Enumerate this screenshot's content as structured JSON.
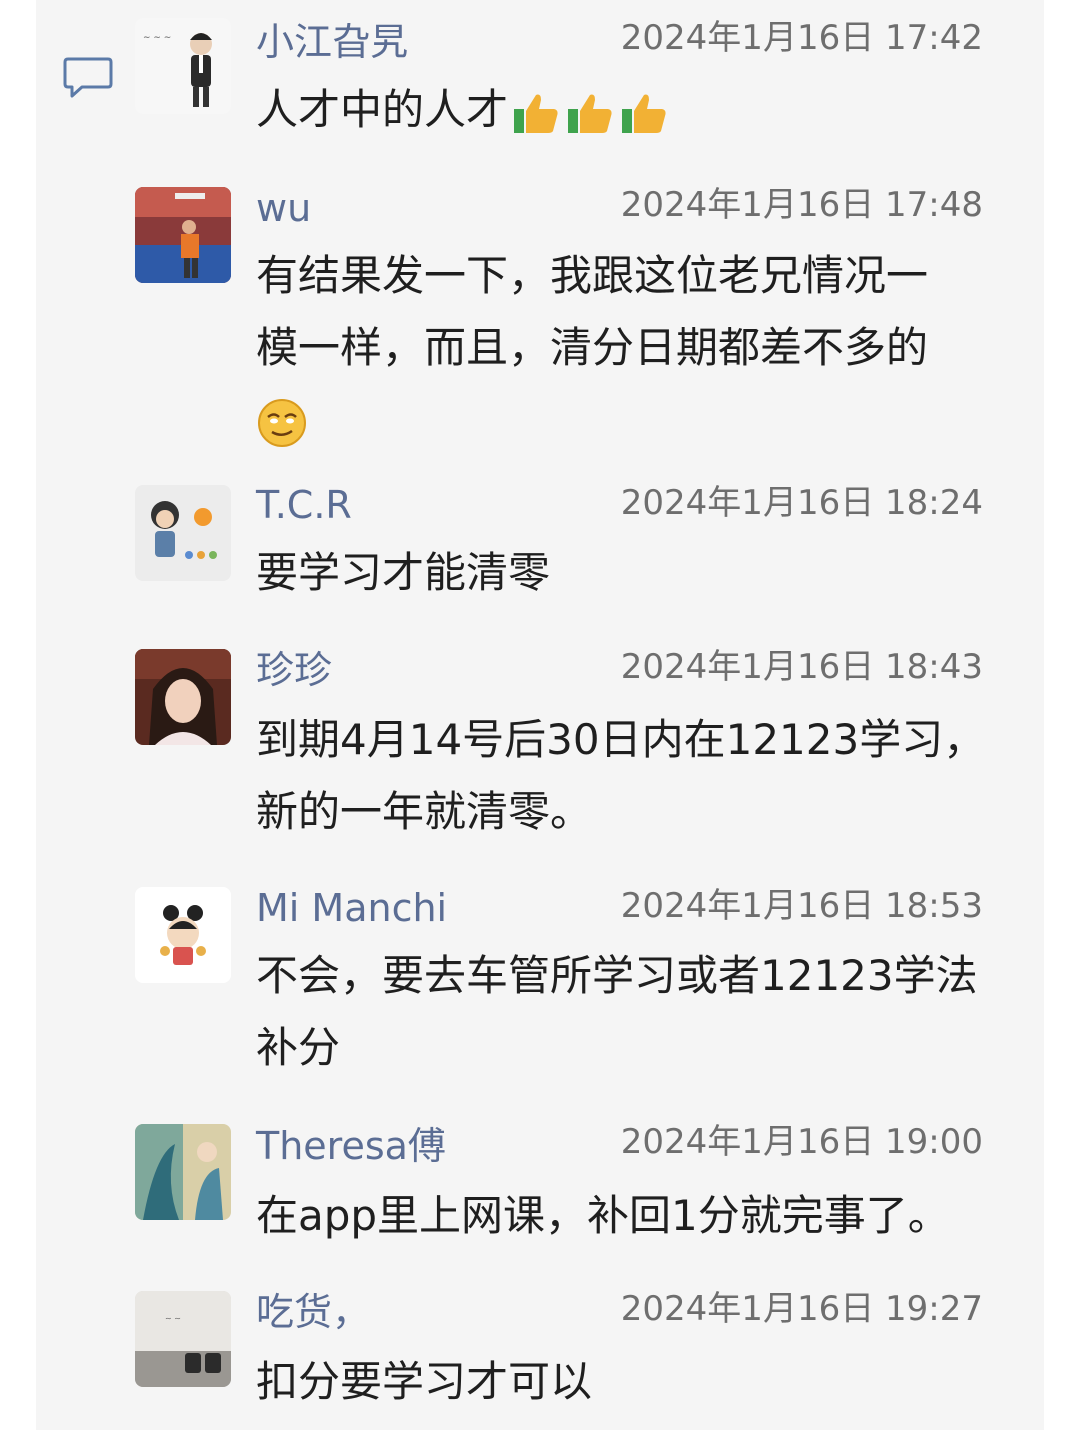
{
  "comments": [
    {
      "name": "小江旮旯",
      "time": "2024年1月16日 17:42",
      "text": "人才中的人才",
      "emojis": [
        "thumbs-up-icon",
        "thumbs-up-icon",
        "thumbs-up-icon"
      ]
    },
    {
      "name": "wu",
      "time": "2024年1月16日 17:48",
      "text_lines": [
        "有结果发一下，我跟这位老兄情况一",
        "模一样，而且，清分日期都差不多的"
      ],
      "emojis": [
        "smirk-face-icon"
      ]
    },
    {
      "name": "T.C.R",
      "time": "2024年1月16日 18:24",
      "text": "要学习才能清零"
    },
    {
      "name": "珍珍",
      "time": "2024年1月16日 18:43",
      "text_lines": [
        "到期4月14号后30日内在12123学习，",
        "新的一年就清零。"
      ]
    },
    {
      "name": "Mi Manchi",
      "time": "2024年1月16日 18:53",
      "text_lines": [
        "不会，要去车管所学习或者12123学法",
        "补分"
      ]
    },
    {
      "name": "Theresa傅",
      "time": "2024年1月16日 19:00",
      "text": "在app里上网课，补回1分就完事了。"
    },
    {
      "name": "吃货，",
      "time": "2024年1月16日 19:27",
      "text": "扣分要学习才可以"
    }
  ],
  "colors": {
    "name": "#5b6d94",
    "time": "#6e6e6e",
    "text": "#1f1f1f",
    "panel": "#f5f5f5",
    "icon": "#5b7aa8"
  }
}
